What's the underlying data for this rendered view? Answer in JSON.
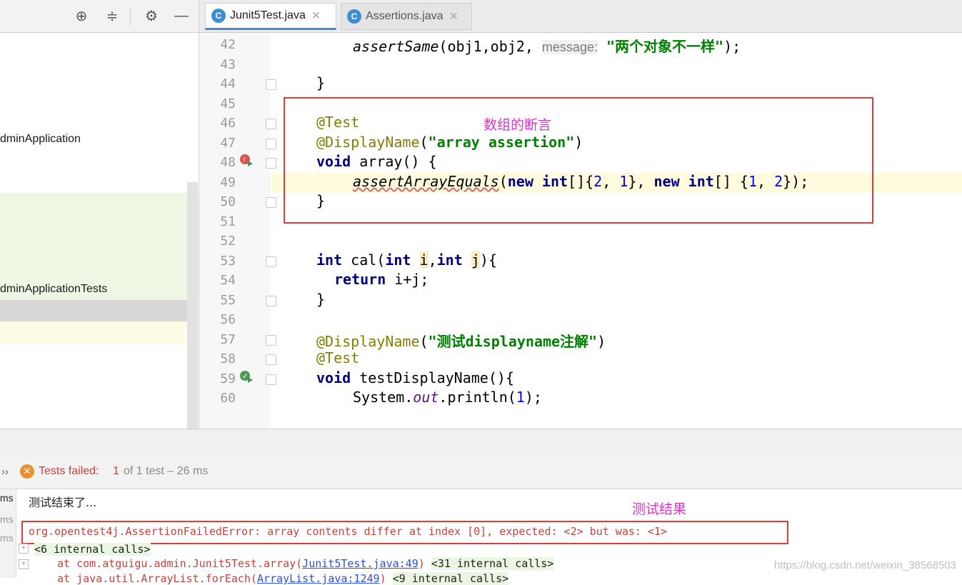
{
  "tabs": [
    {
      "label": "Junit5Test.java",
      "active": true,
      "icon": "class-icon"
    },
    {
      "label": "Assertions.java",
      "active": false,
      "icon": "class-icon"
    }
  ],
  "project_tree": {
    "item_main": "dminApplication",
    "item_tests": "dminApplicationTests"
  },
  "line_numbers": [
    "42",
    "43",
    "44",
    "45",
    "46",
    "47",
    "48",
    "49",
    "50",
    "51",
    "52",
    "53",
    "54",
    "55",
    "56",
    "57",
    "58",
    "59",
    "60"
  ],
  "code": {
    "l42_call": "assertSame",
    "l42_args": "(obj1,obj2, ",
    "l42_hint": "message:",
    "l42_str": "\"两个对象不一样\"",
    "l42_end": ");",
    "l44": "}",
    "l46": "@Test",
    "l47_ann": "@DisplayName",
    "l47_open": "(",
    "l47_str": "\"array assertion\"",
    "l47_close": ")",
    "l48_kw": "void",
    "l48_rest": " array() {",
    "l49_call": "assertArrayEquals",
    "l49_a": "(",
    "l49_new1": "new int",
    "l49_b": "[]{",
    "l49_n1": "2",
    "l49_c": ", ",
    "l49_n2": "1",
    "l49_d": "}, ",
    "l49_new2": "new int",
    "l49_e": "[] {",
    "l49_n3": "1",
    "l49_f": ", ",
    "l49_n4": "2",
    "l49_g": "});",
    "l50": "}",
    "l53_kw1": "int",
    "l53_a": " cal(",
    "l53_kw2": "int",
    "l53_p1": "i",
    "l53_b": ",",
    "l53_kw3": "int",
    "l53_p2": "j",
    "l53_c": "){",
    "l54_kw": "return",
    "l54_rest": " i+j;",
    "l55": "}",
    "l57_ann": "@DisplayName",
    "l57_open": "(",
    "l57_str": "\"测试displayname注解\"",
    "l57_close": ")",
    "l58": "@Test",
    "l59_kw": "void",
    "l59_rest": " testDisplayName(){",
    "l60_a": "System.",
    "l60_field": "out",
    "l60_b": ".println(",
    "l60_num": "1",
    "l60_c": ");"
  },
  "notes": {
    "array_note": "数组的断言",
    "result_note": "测试结果"
  },
  "run": {
    "status_label": "Tests failed:",
    "failed_count": "1",
    "status_rest": "of 1 test – 26 ms",
    "ms_labels": [
      "ms",
      "ms",
      "ms"
    ]
  },
  "console": {
    "line1": "测试结束了...",
    "line2": "org.opentest4j.AssertionFailedError: array contents differ at index [0], expected: <2> but was: <1>",
    "line3": "<6 internal calls>",
    "line4_a": "at com.atguigu.admin.Junit5Test.array(",
    "line4_link": "Junit5Test.java:49",
    "line4_b": ")",
    "line4_internal": "<31 internal calls>",
    "line5_a": "at java.util.ArrayList.forEach(",
    "line5_link": "ArrayList.java:1249",
    "line5_b": ")",
    "line5_internal": "<9 internal calls>"
  },
  "watermark": "https://blog.csdn.net/weixin_38568503",
  "colors": {
    "accent_red_box": "#e13a3a",
    "note_magenta": "#e12fcf",
    "failed_red": "#c5423a"
  }
}
